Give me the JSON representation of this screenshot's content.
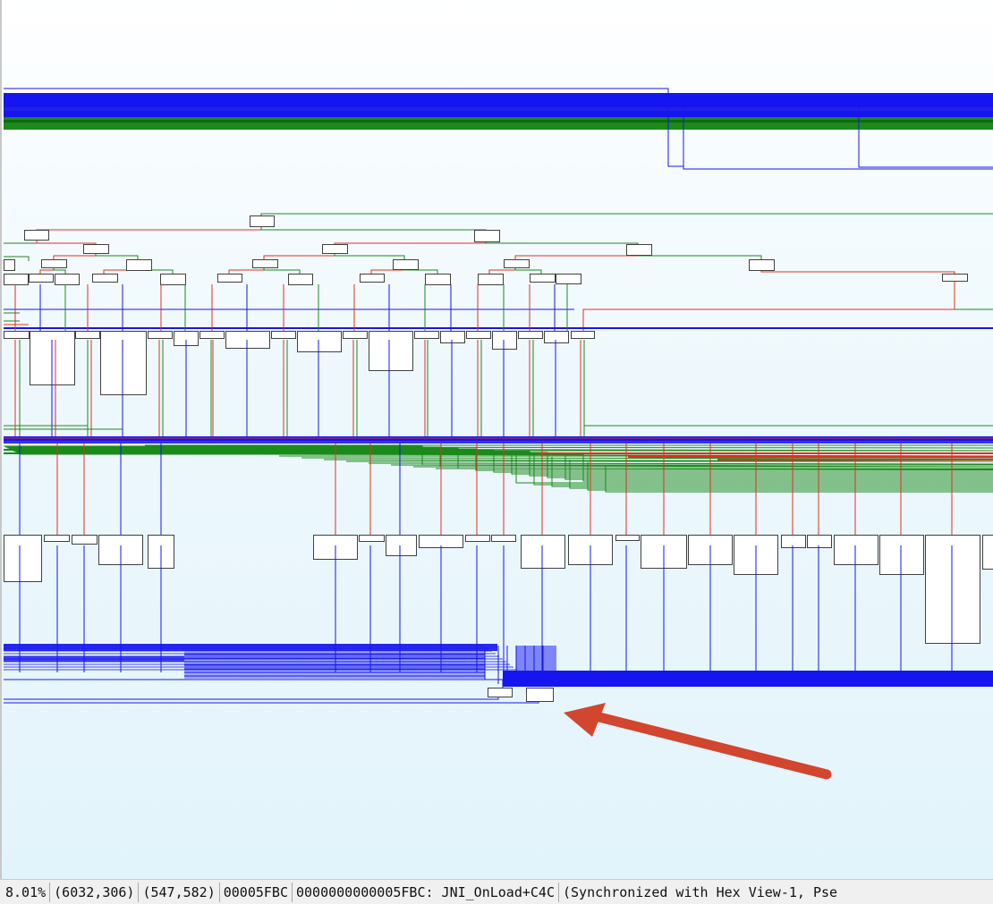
{
  "graph_view": {
    "name": "IDA graph overview",
    "colors": {
      "background_top": "#ffffff",
      "background_bottom": "#e2f4fb",
      "edge_normal": "#1515f0",
      "edge_true": "#1a8a1a",
      "edge_false": "#e03020",
      "node_fill": "#ffffff",
      "node_border": "#404040",
      "annotation_arrow": "#d2452e"
    },
    "annotation": "arrow-pointing-to-small-node"
  },
  "status_bar": {
    "zoom": "8.01%",
    "graph_coords": "(6032,306)",
    "mouse_coords": "(547,582)",
    "offset": "00005FBC",
    "address_location": "0000000000005FBC: JNI_OnLoad+C4C",
    "sync_info": "(Synchronized with Hex View-1, Pse"
  }
}
